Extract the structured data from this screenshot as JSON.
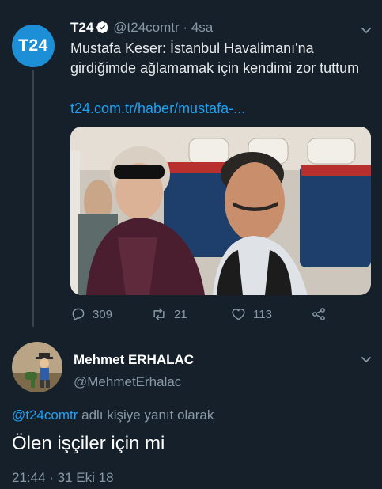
{
  "tweet": {
    "avatar_text": "T24",
    "name": "T24",
    "handle": "@t24comtr",
    "separator": "·",
    "time": "4sa",
    "text": "Mustafa Keser: İstanbul Havalimanı'na girdiğimde ağlamamak için kendimi zor tuttum",
    "link": "t24.com.tr/haber/mustafa-...",
    "counts": {
      "replies": "309",
      "retweets": "21",
      "likes": "113"
    }
  },
  "reply": {
    "name": "Mehmet ERHALAC",
    "handle": "@MehmetErhalac",
    "replying_to_handle": "@t24comtr",
    "replying_to_suffix": "adlı kişiye yanıt olarak",
    "text": "Ölen işçiler için mi",
    "timestamp": "21:44 · 31 Eki 18"
  },
  "colors": {
    "background": "#15202b",
    "accent": "#1da1f2",
    "muted": "#8899a6",
    "t24_brand": "#1d8fd6"
  },
  "icons": [
    "verified-badge-icon",
    "chevron-down-icon",
    "reply-icon",
    "retweet-icon",
    "like-icon",
    "share-icon"
  ]
}
